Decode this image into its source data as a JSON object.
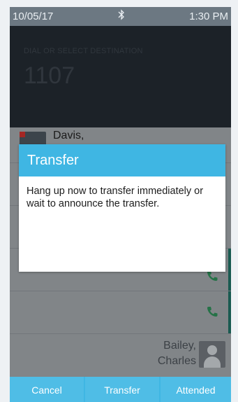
{
  "status_bar": {
    "date": "10/05/17",
    "time": "1:30 PM",
    "bluetooth_icon": "bluetooth-icon"
  },
  "dial": {
    "prompt": "DIAL OR SELECT DESTINATION",
    "number": "1107"
  },
  "contacts": [
    {
      "name": "Davis,"
    },
    {
      "name": "Bailey,",
      "name_line2": "Charles"
    }
  ],
  "dialog": {
    "title": "Transfer",
    "message": "Hang up now to transfer immediately or wait to announce the transfer."
  },
  "buttons": {
    "cancel": "Cancel",
    "transfer": "Transfer",
    "attended": "Attended"
  },
  "colors": {
    "accent": "#3fb6e3",
    "status_bar": "#6c7882",
    "dial_bg": "#232a31",
    "phone_icon": "#2e8b57"
  }
}
